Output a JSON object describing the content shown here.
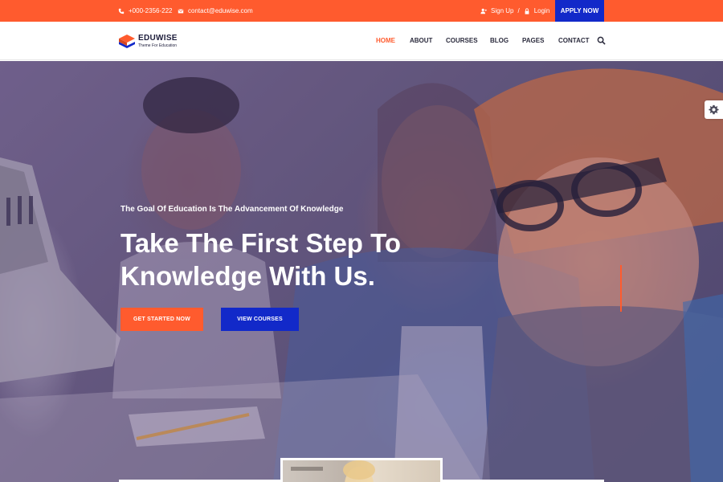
{
  "topbar": {
    "phone": "+000-2356-222",
    "email": "contact@eduwise.com",
    "signup_label": "Sign Up",
    "separator": "/",
    "login_label": "Login",
    "apply_label": "APPLY NOW"
  },
  "brand": {
    "name": "EDUWISE",
    "tagline": "Theme For Education"
  },
  "nav": {
    "items": [
      {
        "label": "HOME",
        "active": true
      },
      {
        "label": "ABOUT",
        "active": false
      },
      {
        "label": "COURSES",
        "active": false
      },
      {
        "label": "BLOG",
        "active": false
      },
      {
        "label": "PAGES",
        "active": false
      },
      {
        "label": "CONTACT",
        "active": false
      }
    ],
    "search_icon": "search-icon"
  },
  "hero": {
    "subtitle": "The Goal Of Education Is The Advancement Of Knowledge",
    "headline_line1": "Take The First Step To",
    "headline_line2": "Knowledge With Us.",
    "primary_button": "GET STARTED NOW",
    "secondary_button": "VIEW COURSES"
  },
  "settings": {
    "icon": "gear-icon"
  },
  "colors": {
    "accent": "#ff5b2e",
    "brand_blue": "#1229c9",
    "text_dark": "#2b2b3d"
  }
}
